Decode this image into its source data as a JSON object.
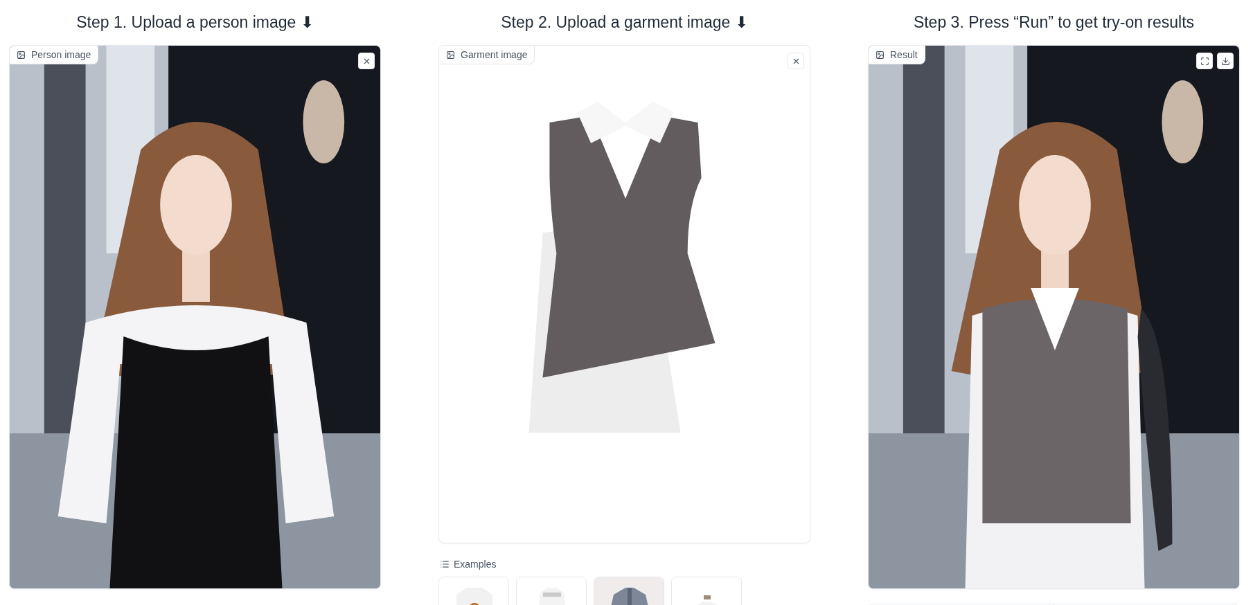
{
  "columns": [
    {
      "heading": "Step 1. Upload a person image ⬇",
      "panel": {
        "label": "Person image",
        "buttons": [
          {
            "kind": "close"
          }
        ]
      }
    },
    {
      "heading": "Step 2. Upload a garment image ⬇",
      "panel": {
        "label": "Garment image",
        "buttons": [
          {
            "kind": "close"
          }
        ]
      },
      "examples": {
        "label": "Examples",
        "items": [
          {
            "kind": "tee"
          },
          {
            "kind": "top"
          },
          {
            "kind": "jacket"
          },
          {
            "kind": "shirt"
          }
        ]
      }
    },
    {
      "heading": "Step 3. Press “Run” to get try-on results",
      "panel": {
        "label": "Result",
        "buttons": [
          {
            "kind": "fullscreen"
          },
          {
            "kind": "download"
          }
        ]
      },
      "below": {
        "kind": "split"
      }
    }
  ]
}
